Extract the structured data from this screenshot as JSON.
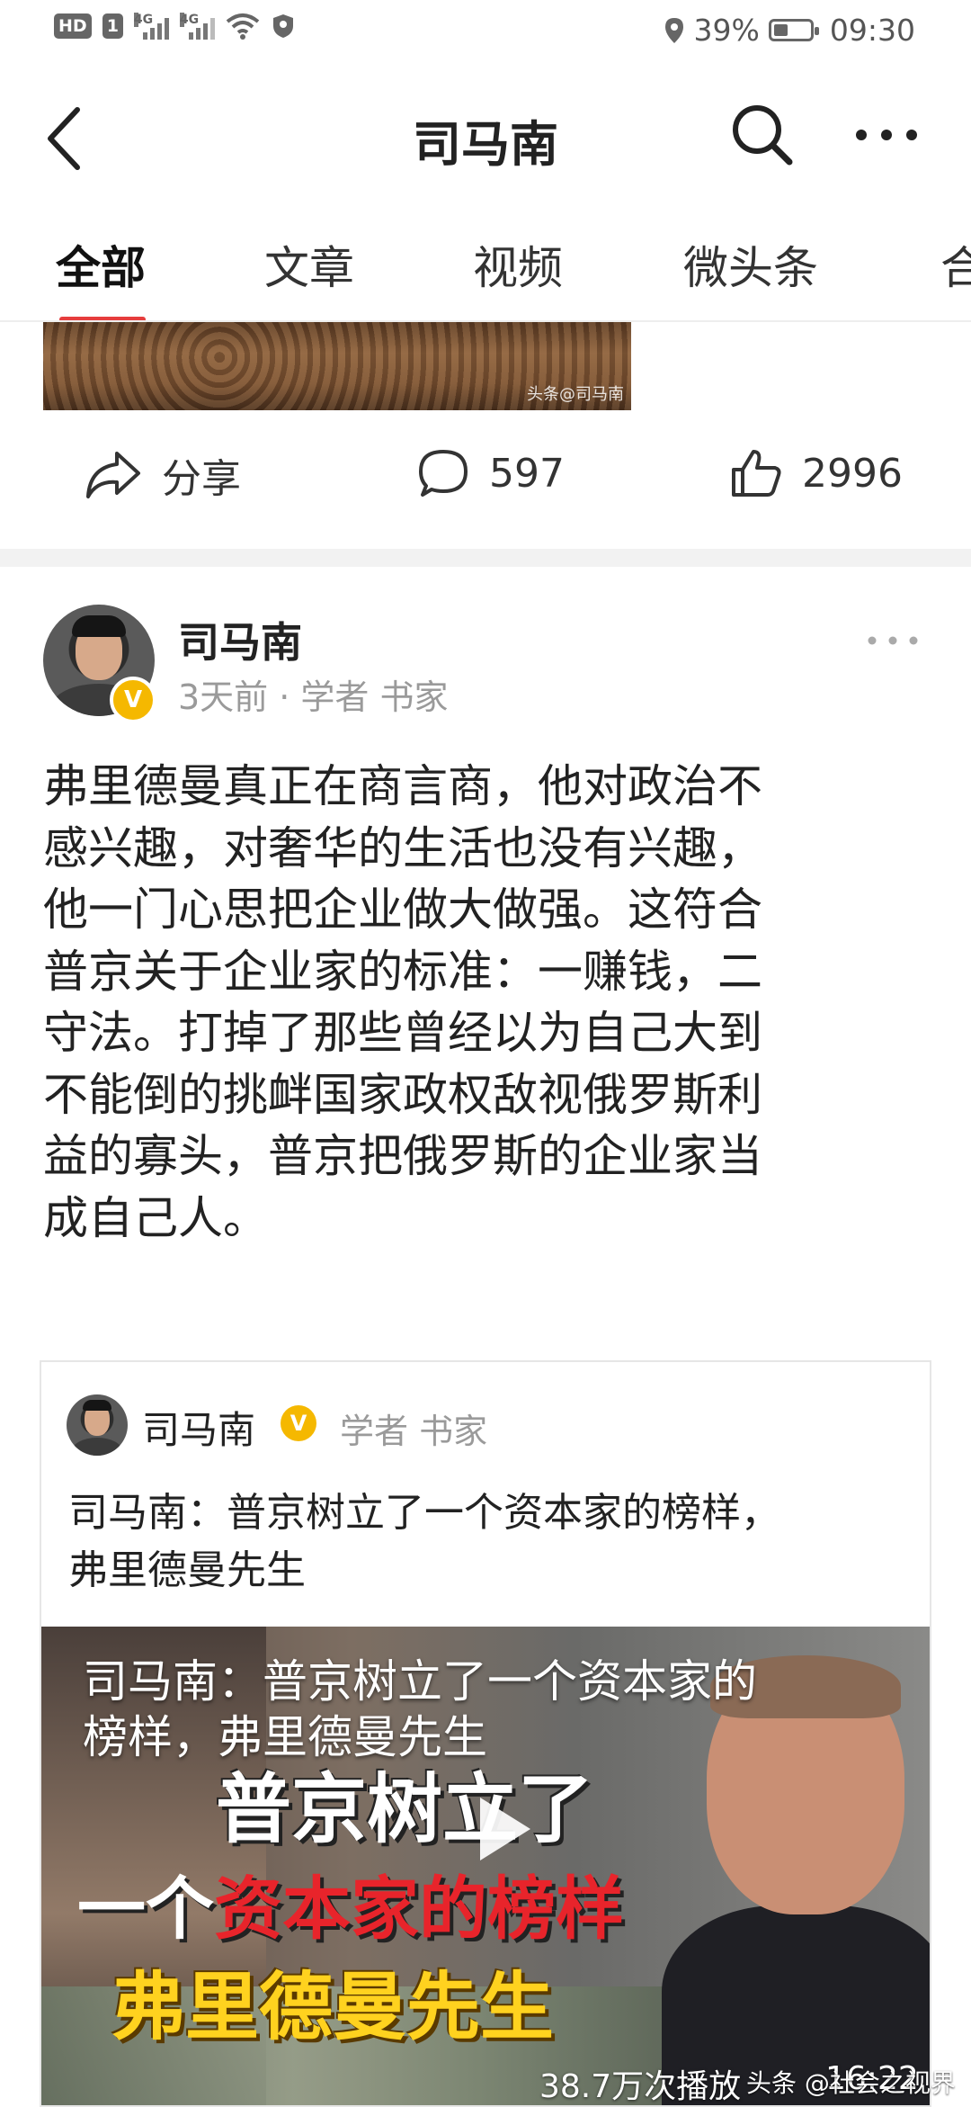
{
  "status_bar": {
    "hd": "HD",
    "sim": "1",
    "net1": "4G",
    "net2": "4G",
    "battery_percent_text": "39%",
    "battery_level": 0.39,
    "time": "09:30"
  },
  "nav": {
    "title": "司马南"
  },
  "tabs": [
    "全部",
    "文章",
    "视频",
    "微头条",
    "合"
  ],
  "previous_post": {
    "image_watermark": "头条@司马南",
    "share_label": "分享",
    "comment_count": "597",
    "like_count": "2996"
  },
  "post": {
    "author": "司马南",
    "verified_mark": "V",
    "meta": "3天前 · 学者 书家",
    "body_lines": [
      "弗里德曼真正在商言商，他对政治不",
      "感兴趣，对奢华的生活也没有兴趣，",
      "他一门心思把企业做大做强。这符合",
      "普京关于企业家的标准：一赚钱，二",
      "守法。打掉了那些曾经以为自己大到",
      "不能倒的挑衅国家政权敌视俄罗斯利",
      "益的寡头，普京把俄罗斯的企业家当",
      "成自己人。"
    ]
  },
  "shared_card": {
    "author": "司马南",
    "verified_mark": "V",
    "meta": "学者 书家",
    "title_lines": [
      "司马南：普京树立了一个资本家的榜样，",
      "弗里德曼先生"
    ],
    "video": {
      "overlay_lines": [
        "司马南：普京树立了一个资本家的",
        "榜样，弗里德曼先生"
      ],
      "big_line1": "普京树立了",
      "big_line2_pre": "一个",
      "big_line2_red": "资本家的榜样",
      "big_line3": "弗里德曼先生",
      "play_count": "38.7万次播放",
      "duration": "16:22",
      "watermark": "头条 @社会之视界"
    }
  },
  "colors": {
    "accent_red": "#e63d3d",
    "verified_gold": "#f5b800",
    "meta_gray": "#9a9a9a"
  },
  "icons": [
    "back-arrow-icon",
    "search-icon",
    "more-dots-icon",
    "share-icon",
    "comment-icon",
    "like-icon",
    "verified-badge-icon",
    "play-icon"
  ]
}
